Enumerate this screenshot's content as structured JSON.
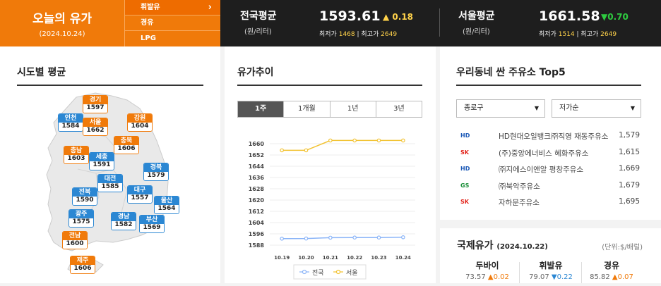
{
  "header": {
    "title": "오늘의 유가",
    "date": "(2024.10.24)",
    "fuel_tabs": [
      "휘발유",
      "경유",
      "LPG"
    ],
    "national": {
      "label": "전국평균",
      "unit": "(원/리터)",
      "price": "1593.61",
      "change": "▲ 0.18",
      "min_label": "최저가",
      "min": "1468",
      "sep": "|",
      "max_label": "최고가",
      "max": "2649"
    },
    "seoul": {
      "label": "서울평균",
      "unit": "(원/리터)",
      "price": "1661.58",
      "change": "▼0.70",
      "min_label": "최저가",
      "min": "1514",
      "sep": "|",
      "max_label": "최고가",
      "max": "2649"
    },
    "colors": {
      "brand_orange": "#f07a0a",
      "up": "#ffd24a",
      "down": "#2ecc40"
    }
  },
  "regional": {
    "title": "시도별 평균",
    "regions": [
      {
        "name": "경기",
        "price": "1597",
        "color": "orange"
      },
      {
        "name": "인천",
        "price": "1584",
        "color": "blue"
      },
      {
        "name": "서울",
        "price": "1662",
        "color": "orange"
      },
      {
        "name": "강원",
        "price": "1604",
        "color": "orange"
      },
      {
        "name": "충북",
        "price": "1606",
        "color": "orange"
      },
      {
        "name": "충남",
        "price": "1603",
        "color": "orange"
      },
      {
        "name": "세종",
        "price": "1591",
        "color": "blue"
      },
      {
        "name": "경북",
        "price": "1579",
        "color": "blue"
      },
      {
        "name": "대전",
        "price": "1585",
        "color": "blue"
      },
      {
        "name": "대구",
        "price": "1557",
        "color": "blue"
      },
      {
        "name": "전북",
        "price": "1590",
        "color": "blue"
      },
      {
        "name": "울산",
        "price": "1564",
        "color": "blue"
      },
      {
        "name": "광주",
        "price": "1575",
        "color": "blue"
      },
      {
        "name": "경남",
        "price": "1582",
        "color": "blue"
      },
      {
        "name": "부산",
        "price": "1569",
        "color": "blue"
      },
      {
        "name": "전남",
        "price": "1600",
        "color": "orange"
      },
      {
        "name": "제주",
        "price": "1606",
        "color": "orange"
      }
    ]
  },
  "trend": {
    "title": "유가추이",
    "tabs": [
      "1주",
      "1개월",
      "1년",
      "3년"
    ],
    "active_tab": "1주",
    "legend": [
      "전국",
      "서울"
    ]
  },
  "chart_data": {
    "type": "line",
    "x": [
      "10.19",
      "10.20",
      "10.21",
      "10.22",
      "10.23",
      "10.24"
    ],
    "y_ticks": [
      1588,
      1596,
      1604,
      1612,
      1620,
      1628,
      1636,
      1644,
      1652,
      1660
    ],
    "ylim": [
      1588,
      1662
    ],
    "series": [
      {
        "name": "전국",
        "color": "#8ab4f8",
        "values": [
          1592.6,
          1592.7,
          1593.3,
          1593.4,
          1593.4,
          1593.6
        ]
      },
      {
        "name": "서울",
        "color": "#f2c230",
        "values": [
          1655.3,
          1655.3,
          1662.3,
          1662.3,
          1662.3,
          1662.3
        ]
      }
    ],
    "legend_placement": "bottom",
    "grid": "horizontal"
  },
  "stations": {
    "title": "우리동네 싼 주유소 Top5",
    "district": "종로구",
    "sort": "저가순",
    "items": [
      {
        "brand": "HD",
        "brand_color": "#1e5bb8",
        "name": "HD현대오일뱅크㈜직영 재동주유소",
        "price": "1,579"
      },
      {
        "brand": "SK",
        "brand_color": "#e2231a",
        "name": "(주)중앙에너비스 혜화주유소",
        "price": "1,615"
      },
      {
        "brand": "HD",
        "brand_color": "#1e5bb8",
        "name": "㈜지에스이앤알 평창주유소",
        "price": "1,669"
      },
      {
        "brand": "GS",
        "brand_color": "#1c8f3a",
        "name": "㈜북악주유소",
        "price": "1,679"
      },
      {
        "brand": "SK",
        "brand_color": "#e2231a",
        "name": "자하문주유소",
        "price": "1,695"
      }
    ]
  },
  "international": {
    "title": "국제유가",
    "date": "(2024.10.22)",
    "unit": "(단위:$/배럴)",
    "items": [
      {
        "name": "두바이",
        "price": "73.57",
        "change": "▲0.02",
        "dir": "up"
      },
      {
        "name": "휘발유",
        "price": "79.07",
        "change": "▼0.22",
        "dir": "down"
      },
      {
        "name": "경유",
        "price": "85.82",
        "change": "▲0.07",
        "dir": "up"
      }
    ]
  }
}
